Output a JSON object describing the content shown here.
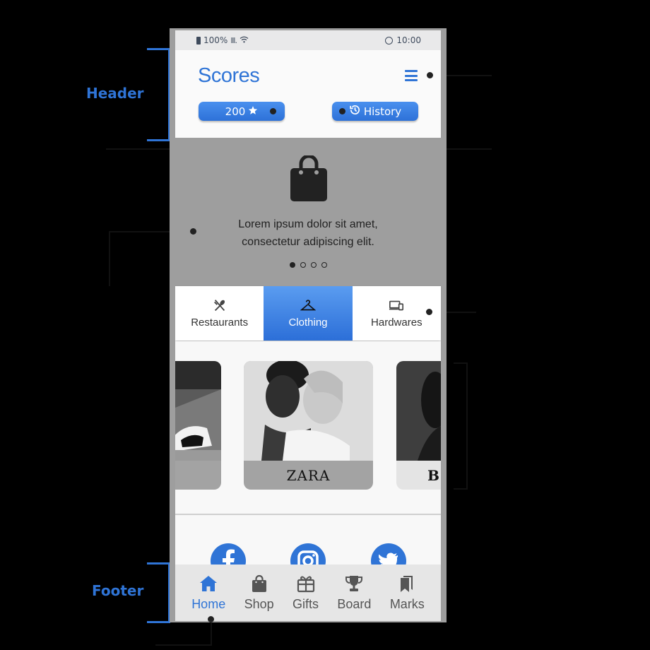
{
  "status_bar": {
    "battery": "100%",
    "signal": "lll.",
    "time": "10:00"
  },
  "header": {
    "logo": "Scores",
    "score_value": "200",
    "history_label": "History"
  },
  "banner": {
    "line1": "Lorem ipsum dolor sit amet,",
    "line2": "consectetur adipiscing elit."
  },
  "tabs": [
    {
      "label": "Restaurants",
      "icon": "fork-knife-icon"
    },
    {
      "label": "Clothing",
      "icon": "hanger-icon"
    },
    {
      "label": "Hardwares",
      "icon": "devices-icon"
    }
  ],
  "brands": [
    {
      "name": ""
    },
    {
      "name": "ZARA"
    },
    {
      "name": "BO"
    }
  ],
  "footer": {
    "items": [
      {
        "label": "Home",
        "icon": "home-icon"
      },
      {
        "label": "Shop",
        "icon": "shopping-bag-icon"
      },
      {
        "label": "Gifts",
        "icon": "gift-icon"
      },
      {
        "label": "Board",
        "icon": "trophy-icon"
      },
      {
        "label": "Marks",
        "icon": "bookmarks-icon"
      }
    ]
  },
  "annotations": {
    "header": "Header",
    "footer": "Footer"
  },
  "colors": {
    "accent": "#2f74d6",
    "frame": "#9e9e9e",
    "background": "#000000"
  }
}
